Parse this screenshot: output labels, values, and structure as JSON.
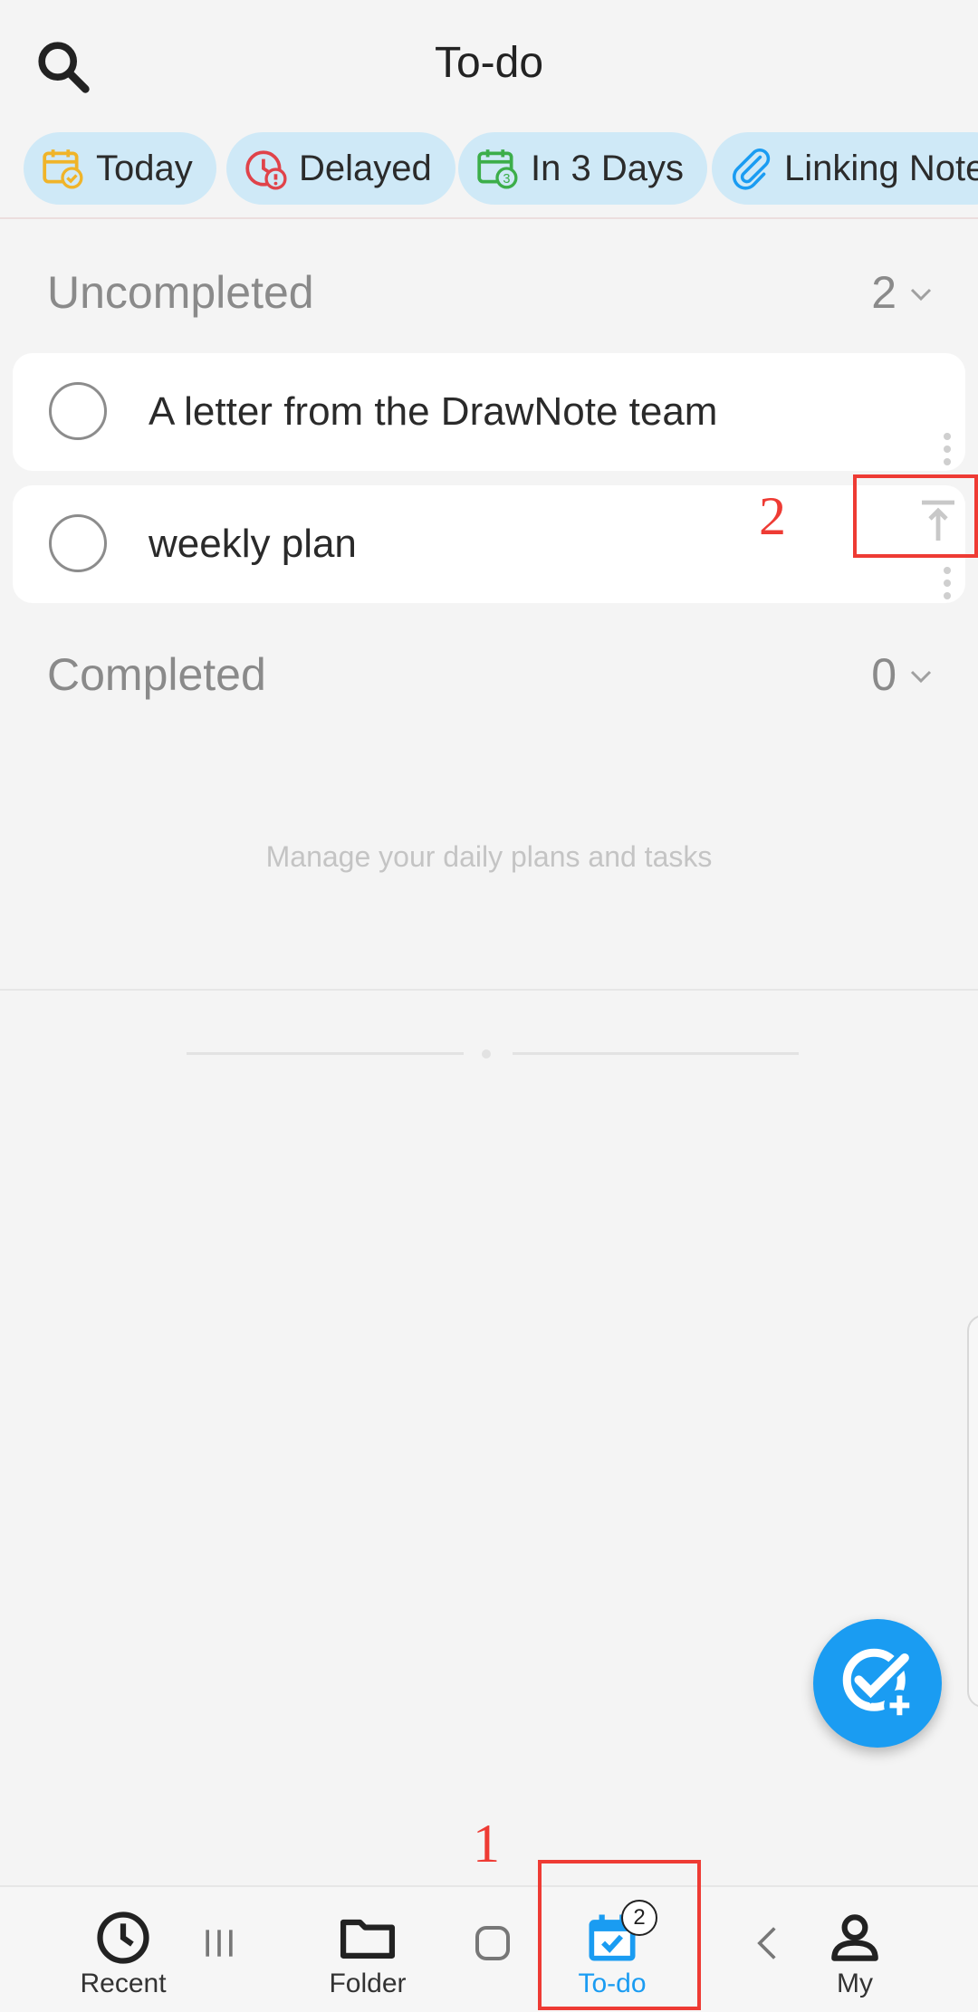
{
  "header": {
    "title": "To-do",
    "search_icon": "search-icon"
  },
  "filters": [
    {
      "label": "Today",
      "icon": "calendar-check-icon",
      "color": "#f0b429"
    },
    {
      "label": "Delayed",
      "icon": "clock-alert-icon",
      "color": "#e0434a"
    },
    {
      "label": "In 3 Days",
      "icon": "calendar-3-icon",
      "color": "#3cae4a"
    },
    {
      "label": "Linking Note",
      "icon": "paperclip-icon",
      "color": "#1a9cf2"
    }
  ],
  "sections": {
    "uncompleted": {
      "label": "Uncompleted",
      "count": "2"
    },
    "completed": {
      "label": "Completed",
      "count": "0"
    }
  },
  "tasks": [
    {
      "title": "A letter from the DrawNote team"
    },
    {
      "title": "weekly plan"
    }
  ],
  "empty_hint": "Manage your daily plans and tasks",
  "bottom_nav": [
    {
      "label": "Recent",
      "icon": "clock-icon"
    },
    {
      "label": "Folder",
      "icon": "folder-icon"
    },
    {
      "label": "To-do",
      "icon": "calendar-check-icon",
      "badge": "2",
      "active": true
    },
    {
      "label": "My",
      "icon": "person-icon"
    }
  ],
  "annotations": {
    "box_1_number": "1",
    "box_2_number": "2"
  },
  "colors": {
    "accent": "#1a9cf2",
    "chip_bg": "#cfe9f7",
    "background": "#f4f4f4",
    "annotation": "#ee3b34"
  }
}
